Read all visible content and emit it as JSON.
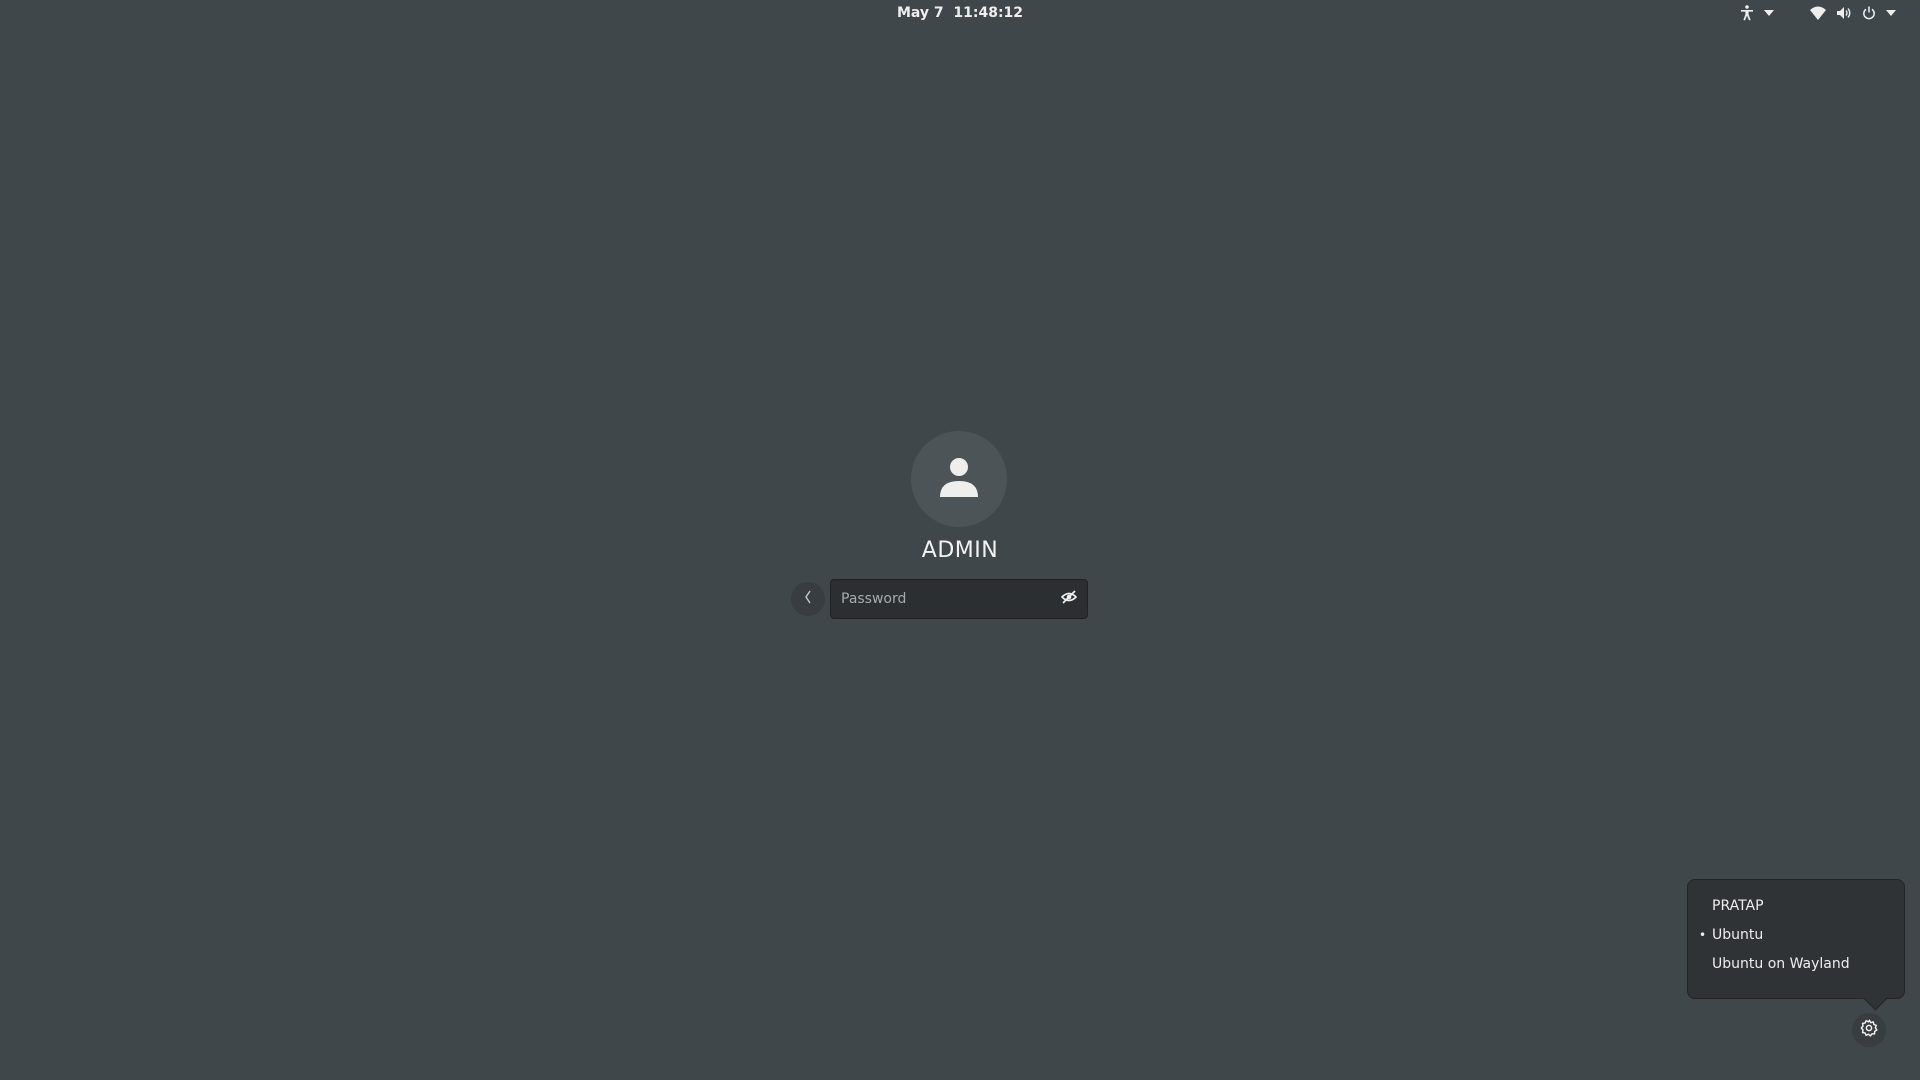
{
  "topbar": {
    "date": "May 7",
    "time": "11:48:12",
    "icons": [
      "accessibility-icon",
      "dropdown-arrow-icon",
      "wifi-icon",
      "volume-icon",
      "power-icon",
      "dropdown-arrow-icon"
    ]
  },
  "login": {
    "username": "ADMIN",
    "password_placeholder": "Password",
    "password_value": "",
    "avatar_icon": "user-icon",
    "back_icon": "chevron-left-icon",
    "reveal_icon": "eye-hidden-icon"
  },
  "session_menu": {
    "items": [
      {
        "label": "PRATAP",
        "selected": false
      },
      {
        "label": "Ubuntu",
        "selected": true
      },
      {
        "label": "Ubuntu on Wayland",
        "selected": false
      }
    ],
    "selected_marker": "•",
    "button_icon": "gear-icon"
  },
  "colors": {
    "background": "#3f474b",
    "popover": "#2f3335",
    "entry": "#2b2f31",
    "text": "#eeeeec"
  }
}
